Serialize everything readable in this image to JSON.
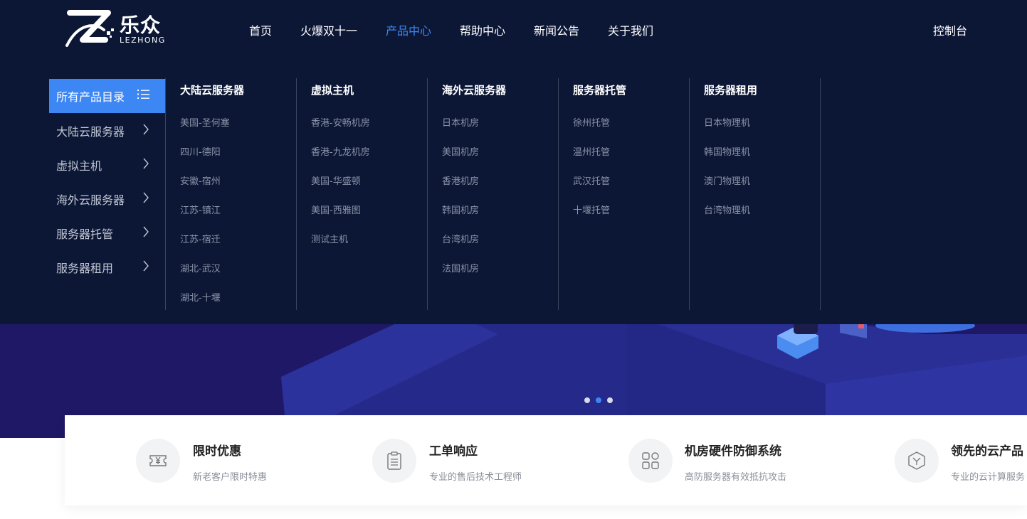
{
  "brand": {
    "name": "乐众",
    "sub": "LEZHONG"
  },
  "nav": {
    "items": [
      {
        "label": "首页",
        "active": false
      },
      {
        "label": "火爆双十一",
        "active": false
      },
      {
        "label": "产品中心",
        "active": true
      },
      {
        "label": "帮助中心",
        "active": false
      },
      {
        "label": "新闻公告",
        "active": false
      },
      {
        "label": "关于我们",
        "active": false
      }
    ],
    "console": "控制台"
  },
  "menu": {
    "header": "所有产品目录",
    "categories": [
      "大陆云服务器",
      "虚拟主机",
      "海外云服务器",
      "服务器托管",
      "服务器租用"
    ],
    "columns": [
      {
        "title": "大陆云服务器",
        "links": [
          "美国-圣何塞",
          "四川-德阳",
          "安徽-宿州",
          "江苏-镇江",
          "江苏-宿迁",
          "湖北-武汉",
          "湖北-十堰"
        ]
      },
      {
        "title": "虚拟主机",
        "links": [
          "香港-安畅机房",
          "香港-九龙机房",
          "美国-华盛顿",
          "美国-西雅图",
          "测试主机"
        ]
      },
      {
        "title": "海外云服务器",
        "links": [
          "日本机房",
          "美国机房",
          "香港机房",
          "韩国机房",
          "台湾机房",
          "法国机房"
        ]
      },
      {
        "title": "服务器托管",
        "links": [
          "徐州托管",
          "温州托管",
          "武汉托管",
          "十堰托管"
        ]
      },
      {
        "title": "服务器租用",
        "links": [
          "日本物理机",
          "韩国物理机",
          "澳门物理机",
          "台湾物理机"
        ]
      }
    ]
  },
  "carousel": {
    "count": 3,
    "active_index": 1
  },
  "features": [
    {
      "title": "限时优惠",
      "desc": "新老客户限时特惠",
      "icon": "ticket-yen-icon"
    },
    {
      "title": "工单响应",
      "desc": "专业的售后技术工程师",
      "icon": "clipboard-icon"
    },
    {
      "title": "机房硬件防御系统",
      "desc": "高防服务器有效抵抗攻击",
      "icon": "grid-icon"
    },
    {
      "title": "领先的云产品",
      "desc": "专业的云计算服务",
      "icon": "cube-icon"
    }
  ],
  "colors": {
    "nav_bg": "#0c1736",
    "accent": "#3d87f5",
    "hero_bg": "#1f1866"
  }
}
